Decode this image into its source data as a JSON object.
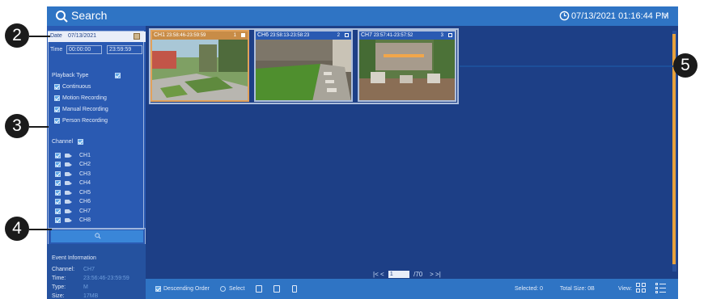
{
  "window": {
    "title": "Search",
    "datetime": "07/13/2021 01:16:44 PM",
    "close_glyph": "×"
  },
  "filters": {
    "date_label": "Date",
    "date_value": "07/13/2021",
    "time_label": "Time",
    "time_start": "00:00:00",
    "time_end": "23:59:59",
    "playback_type_label": "Playback Type",
    "playback_types": [
      "Continuous",
      "Motion Recording",
      "Manual Recording",
      "Person Recording"
    ],
    "channel_label": "Channel",
    "channels": [
      "CH1",
      "CH2",
      "CH3",
      "CH4",
      "CH5",
      "CH6",
      "CH7",
      "CH8"
    ]
  },
  "event_info": {
    "title": "Event Information",
    "channel_label": "Channel:",
    "channel_value": "CH7",
    "time_label": "Time:",
    "time_value": "23:56:46-23:59:59",
    "type_label": "Type:",
    "type_value": "M",
    "size_label": "Size:",
    "size_value": "17MB"
  },
  "results": [
    {
      "channel": "CH1",
      "time": "23:58:46-23:59:59",
      "index": "1",
      "selected": true
    },
    {
      "channel": "CH6",
      "time": "23:58:13-23:58:23",
      "index": "2",
      "selected": false
    },
    {
      "channel": "CH7",
      "time": "23:57:41-23:57:52",
      "index": "3",
      "selected": false
    }
  ],
  "pager": {
    "first": "|<",
    "prev": "<",
    "current_page": "1",
    "total": "/70",
    "next": ">",
    "last": ">|"
  },
  "toolbar": {
    "descending_label": "Descending Order",
    "select_label": "Select",
    "selected_text": "Selected: 0",
    "total_size_text": "Total Size: 0B",
    "view_label": "View:"
  },
  "callouts": [
    "2",
    "3",
    "4",
    "5"
  ],
  "colors": {
    "title_bar": "#2f74c4",
    "panel_bg": "#1d3f86",
    "sidebar_bg": "#2a5ab2",
    "scrollbar_accent": "#e8a13c",
    "checkbox": "#5fa8e8"
  },
  "icons": [
    "search-icon",
    "clock-icon",
    "close-icon",
    "calendar-icon",
    "checkbox-icon",
    "camera-icon",
    "export-icon",
    "play-icon",
    "trash-icon",
    "grid-view-icon",
    "list-view-icon"
  ]
}
